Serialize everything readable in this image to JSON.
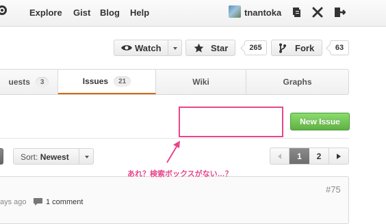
{
  "header": {
    "nav": [
      "Explore",
      "Gist",
      "Blog",
      "Help"
    ],
    "username": "tnantoka",
    "icons": [
      "github-mark-icon",
      "new-repo-icon",
      "settings-icon",
      "sign-out-icon"
    ]
  },
  "repo_actions": {
    "watch_label": "Watch",
    "star_label": "Star",
    "star_count": "265",
    "fork_label": "Fork",
    "fork_count": "63"
  },
  "tabs": [
    {
      "label": "uests",
      "count": "3"
    },
    {
      "label": "Issues",
      "count": "21",
      "selected": true
    },
    {
      "label": "Wiki"
    },
    {
      "label": "Graphs"
    }
  ],
  "new_issue_label": "New Issue",
  "sort": {
    "prefix": "Sort:",
    "value": "Newest"
  },
  "pagination": {
    "pages": [
      "1",
      "2"
    ],
    "current": "1"
  },
  "annotation": "あれ？検索ボックスがない…？",
  "issue": {
    "number": "#75",
    "age_text": "ays ago",
    "comments": "1 comment"
  },
  "colors": {
    "accent_pink": "#e8458b",
    "green_button": "#60b044",
    "tab_underline": "#d26911"
  }
}
